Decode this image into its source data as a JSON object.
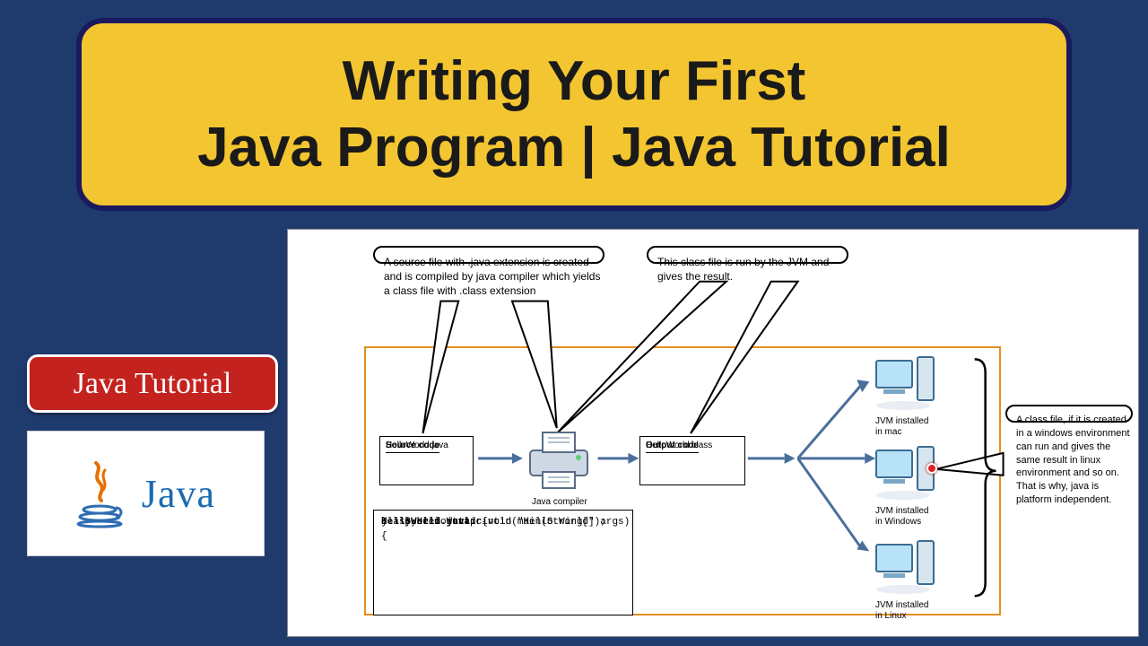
{
  "title": {
    "line1": "Writing Your First",
    "line2": "Java Program | Java Tutorial"
  },
  "badge": "Java Tutorial",
  "logo_text": "Java",
  "callouts": {
    "source": "A source file with .java extension is created and is compiled by java compiler which yields a class file with .class extension",
    "run": "This class file is run by the JVM and gives the result.",
    "platform": "A class file, if it is created in a windows environment can run and gives the same result in linux environment and so on. That is why, java is platform independent."
  },
  "source_box": {
    "header": "Source code",
    "value": "HelloWorld.java"
  },
  "output_box": {
    "header": "Output code",
    "value": "HelloWorld.class"
  },
  "compiler_label": "Java compiler",
  "code": {
    "filename": "HelloWorld.java",
    "l1": "class HelloWorld {",
    "l2": "    public static void main(String[] args){",
    "l3": "    System.out.println(\"Hello World\");",
    "l4": "    }",
    "l5": "}"
  },
  "jvm": {
    "mac": "JVM installed\nin mac",
    "windows": "JVM installed\nin Windows",
    "linux": "JVM installed\nin Linux"
  }
}
